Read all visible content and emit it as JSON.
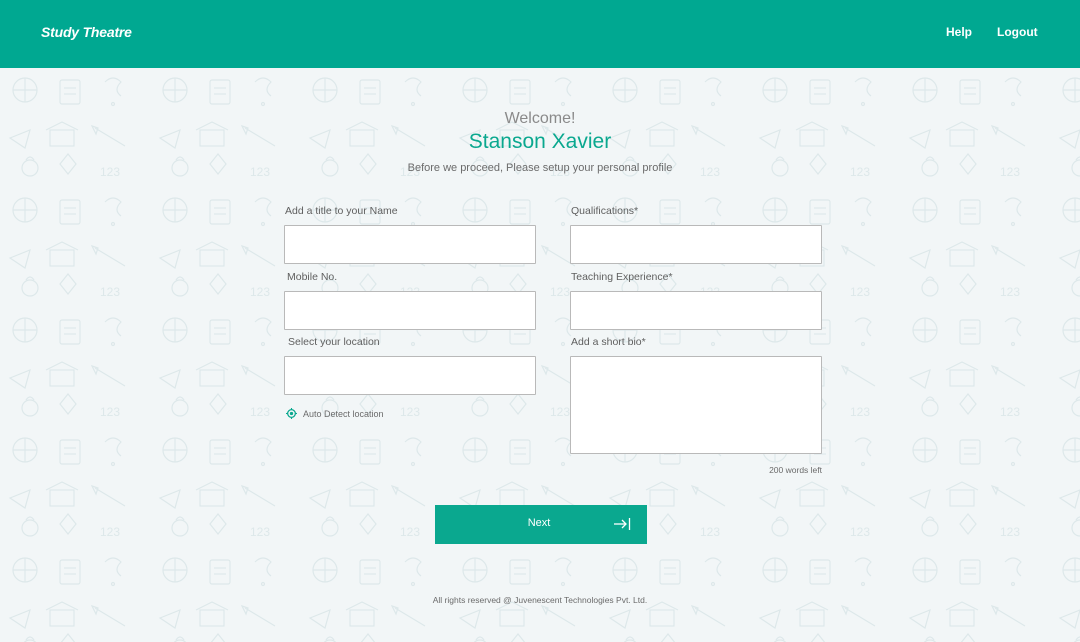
{
  "header": {
    "brand": "Study Theatre",
    "nav": {
      "help": "Help",
      "logout": "Logout"
    }
  },
  "welcome": {
    "greeting": "Welcome!",
    "name": "Stanson Xavier",
    "subtitle": "Before we proceed, Please setup your personal profile"
  },
  "form": {
    "title_label": "Add a title to your Name",
    "title_value": "",
    "mobile_label": "Mobile No.",
    "mobile_value": "",
    "location_label": "Select your location",
    "location_value": "",
    "auto_detect_label": "Auto Detect location",
    "qualifications_label": "Qualifications*",
    "qualifications_value": "",
    "experience_label": "Teaching Experience*",
    "experience_value": "",
    "bio_label": "Add a short bio*",
    "bio_value": "",
    "words_left": "200 words left"
  },
  "actions": {
    "next_label": "Next",
    "next_icon": "arrow-right-to-bar-icon"
  },
  "footer": {
    "text": "All rights reserved @ Juvenescent Technologies Pvt. Ltd."
  },
  "colors": {
    "brand": "#00a891",
    "accent": "#0aa88f",
    "background": "#f2f6f7"
  },
  "icons": {
    "auto_detect": "location-target-icon",
    "background": "education-doodle-pattern"
  }
}
